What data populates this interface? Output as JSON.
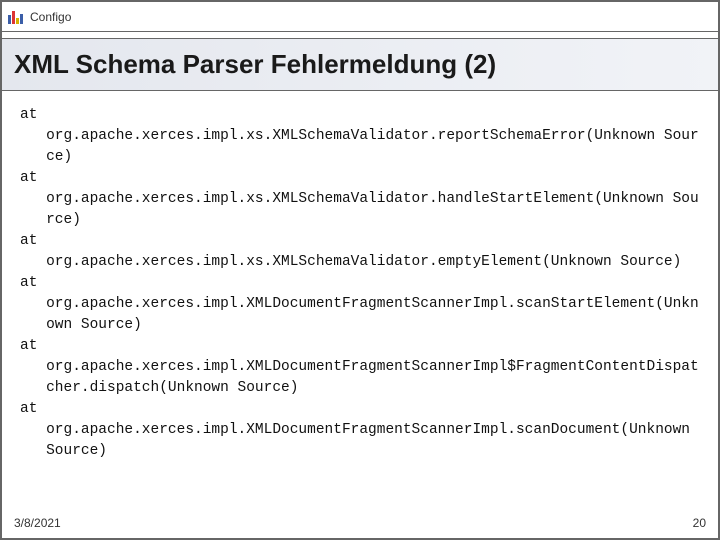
{
  "header": {
    "brand": "Configo"
  },
  "title": "XML Schema Parser Fehlermeldung (2)",
  "stack": {
    "at_label": "at",
    "entries": [
      "org.apache.xerces.impl.xs.XMLSchemaValidator.reportSchemaError(Unknown Source)",
      "org.apache.xerces.impl.xs.XMLSchemaValidator.handleStartElement(Unknown Source)",
      "org.apache.xerces.impl.xs.XMLSchemaValidator.emptyElement(Unknown Source)",
      "org.apache.xerces.impl.XMLDocumentFragmentScannerImpl.scanStartElement(Unknown Source)",
      "org.apache.xerces.impl.XMLDocumentFragmentScannerImpl$FragmentContentDispatcher.dispatch(Unknown Source)",
      "org.apache.xerces.impl.XMLDocumentFragmentScannerImpl.scanDocument(Unknown Source)"
    ]
  },
  "footer": {
    "date": "3/8/2021",
    "page": "20"
  }
}
